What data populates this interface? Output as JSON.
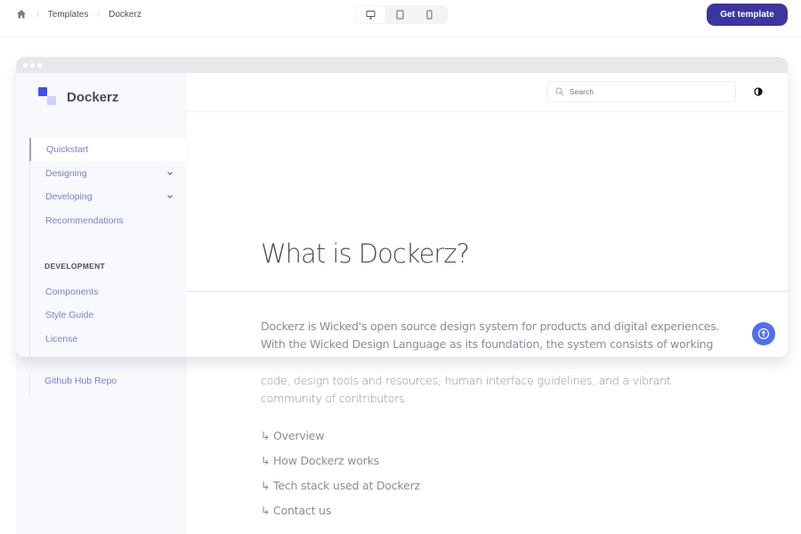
{
  "topbar": {
    "breadcrumb": [
      "Templates",
      "Dockerz"
    ],
    "devices": [
      {
        "name": "desktop",
        "active": true
      },
      {
        "name": "tablet",
        "active": false
      },
      {
        "name": "mobile",
        "active": false
      }
    ],
    "get_template_label": "Get template",
    "accent": "#3b36a0"
  },
  "app": {
    "brand": "Dockerz",
    "search_placeholder": "Search",
    "nav": [
      {
        "label": "Quickstart",
        "active": true,
        "expandable": false
      },
      {
        "label": "Designing",
        "active": false,
        "expandable": true
      },
      {
        "label": "Developing",
        "active": false,
        "expandable": true
      },
      {
        "label": "Recommendations",
        "active": false,
        "expandable": false
      }
    ],
    "section_heading": "DEVELOPMENT",
    "section_items": [
      "Components",
      "Style Guide",
      "License",
      "Github Hub Repo"
    ],
    "page_title": "What is Dockerz?",
    "intro_lines": [
      "Dockerz is Wicked's open source design system for products and digital experiences.",
      "With the Wicked Design Language as its foundation, the system consists of working",
      "code, design tools and resources, human interface guidelines, and a vibrant",
      "community of contributors."
    ],
    "toc": [
      "↳ Overview",
      "↳ How Dockerz works",
      "↳ Tech stack used at Dockerz",
      "↳ Contact us"
    ],
    "brand_color": "#3f51f1",
    "link_color": "#7a7fd0"
  }
}
